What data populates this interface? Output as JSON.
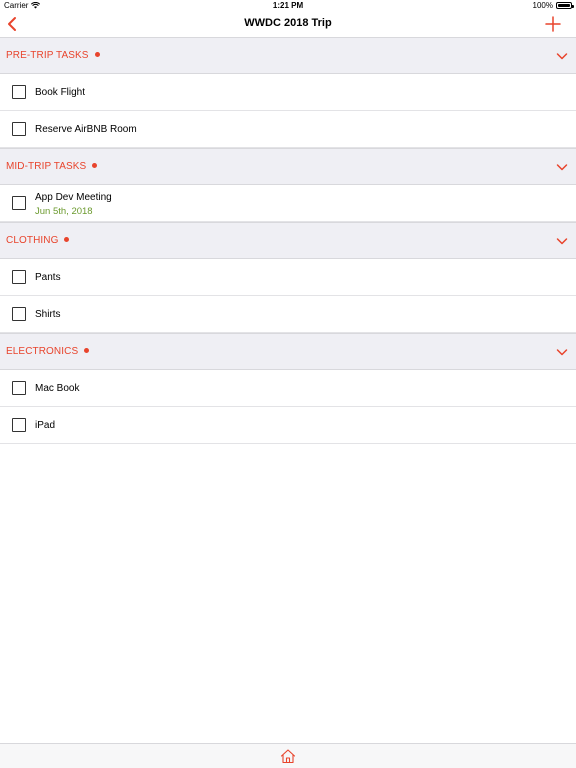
{
  "status_bar": {
    "carrier": "Carrier",
    "time": "1:21 PM",
    "battery": "100%"
  },
  "nav": {
    "title": "WWDC 2018 Trip"
  },
  "colors": {
    "accent": "#e8442c",
    "date_green": "#6b9a2e",
    "section_bg": "#efeff4"
  },
  "sections": [
    {
      "title": "PRE-TRIP TASKS",
      "items": [
        {
          "label": "Book Flight"
        },
        {
          "label": "Reserve AirBNB Room"
        }
      ]
    },
    {
      "title": "MID-TRIP TASKS",
      "items": [
        {
          "label": "App Dev Meeting",
          "date": "Jun 5th, 2018"
        }
      ]
    },
    {
      "title": "CLOTHING",
      "items": [
        {
          "label": "Pants"
        },
        {
          "label": "Shirts"
        }
      ]
    },
    {
      "title": "ELECTRONICS",
      "items": [
        {
          "label": "Mac Book"
        },
        {
          "label": "iPad"
        }
      ]
    }
  ],
  "icons": {
    "back": "chevron-left-icon",
    "add": "plus-icon",
    "expand": "chevron-down-icon",
    "home": "home-icon",
    "wifi": "wifi-icon",
    "battery": "battery-icon"
  }
}
